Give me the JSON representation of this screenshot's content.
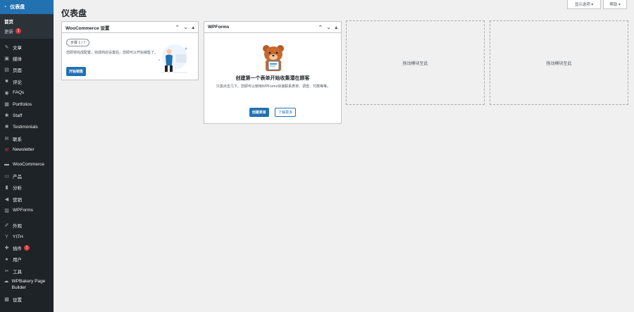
{
  "page": {
    "title": "仪表盘"
  },
  "topbar": {
    "screen_options": "显示选项 ▾",
    "help": "帮助 ▾"
  },
  "sidebar": {
    "active": "仪表盘",
    "sub": [
      {
        "label": "首页",
        "current": true
      },
      {
        "label": "更新",
        "badge": "1"
      }
    ],
    "items": [
      {
        "label": "文章",
        "icon": "pin-icon"
      },
      {
        "label": "媒体",
        "icon": "media-icon"
      },
      {
        "label": "页面",
        "icon": "page-icon"
      },
      {
        "label": "评论",
        "icon": "comment-icon"
      },
      {
        "label": "FAQs",
        "icon": "faq-icon"
      },
      {
        "label": "Portfolios",
        "icon": "portfolio-icon"
      },
      {
        "label": "Staff",
        "icon": "staff-icon"
      },
      {
        "label": "Testimonials",
        "icon": "testimonial-icon"
      },
      {
        "label": "联系",
        "icon": "mail-icon"
      },
      {
        "label": "Newsletter",
        "icon": "newsletter-icon"
      },
      {
        "label": "WooCommerce",
        "icon": "woo-icon"
      },
      {
        "label": "产品",
        "icon": "product-icon"
      },
      {
        "label": "分析",
        "icon": "analytics-icon"
      },
      {
        "label": "营销",
        "icon": "megaphone-icon"
      },
      {
        "label": "WPForms",
        "icon": "wpforms-icon"
      },
      {
        "label": "外观",
        "icon": "brush-icon"
      },
      {
        "label": "YITH",
        "icon": "yith-icon"
      },
      {
        "label": "插件",
        "icon": "plugin-icon",
        "badge": "1"
      },
      {
        "label": "用户",
        "icon": "user-icon"
      },
      {
        "label": "工具",
        "icon": "tool-icon"
      },
      {
        "label": "WPBakery Page Builder",
        "icon": "wpbakery-icon"
      },
      {
        "label": "设置",
        "icon": "settings-icon"
      }
    ]
  },
  "woo_box": {
    "title": "WooCommerce 设置",
    "step": "步骤 1 / 7",
    "desc": "您即将完成配置，完成商店设置后，您即可以开始销售了。",
    "button": "开始销售"
  },
  "wpforms_box": {
    "title": "WPForms",
    "headline": "创建第一个表单开始收集潜在顾客",
    "sub": "只需点击几下，您即可以使用WPForms快速联系表单、调查、付款等等。",
    "btn_primary": "创建表单",
    "btn_secondary": "了解更多"
  },
  "drop_zones": [
    "拖动模块至此",
    "拖动模块至此"
  ],
  "colors": {
    "sidebar": "#1d2327",
    "accent": "#2271b1",
    "badge": "#d63638"
  }
}
